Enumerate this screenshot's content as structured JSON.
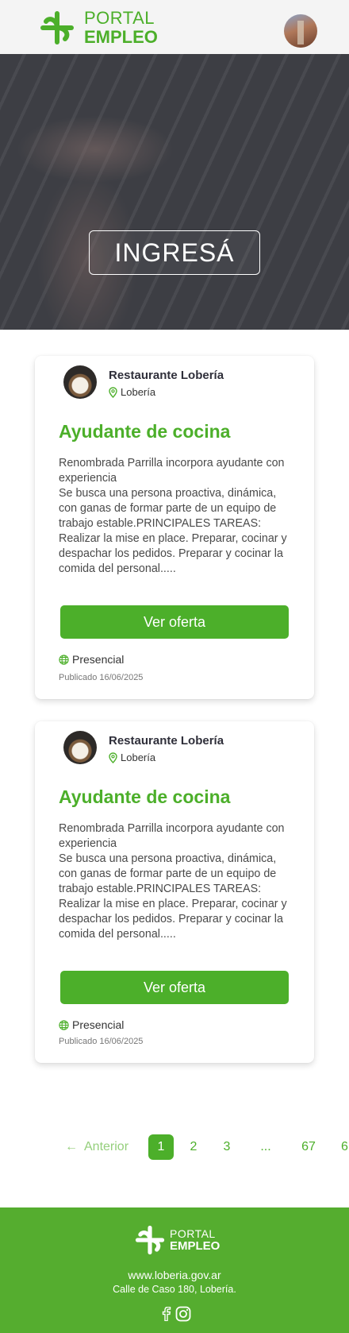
{
  "header": {
    "logo_line1": "PORTAL",
    "logo_line2": "EMPLEO",
    "avatar_icon": "user-avatar"
  },
  "hero": {
    "login_label": "INGRESÁ"
  },
  "jobs": [
    {
      "company": "Restaurante Lobería",
      "location": "Lobería",
      "title": "Ayudante de cocina",
      "description": "Renombrada Parrilla incorpora ayudante con experiencia\nSe busca una persona proactiva, dinámica, con ganas de formar parte de un equipo de trabajo estable.PRINCIPALES TAREAS: Realizar la mise en place. Preparar, cocinar y despachar los pedidos. Preparar y cocinar la comida del personal.....",
      "cta": "Ver oferta",
      "modality": "Presencial",
      "published": "Publicado 16/06/2025"
    },
    {
      "company": "Restaurante Lobería",
      "location": "Lobería",
      "title": "Ayudante de cocina",
      "description": "Renombrada Parrilla incorpora ayudante con experiencia\nSe busca una persona proactiva, dinámica, con ganas de formar parte de un equipo de trabajo estable.PRINCIPALES TAREAS: Realizar la mise en place. Preparar, cocinar y despachar los pedidos. Preparar y cocinar la comida del personal.....",
      "cta": "Ver oferta",
      "modality": "Presencial",
      "published": "Publicado 16/06/2025"
    }
  ],
  "pagination": {
    "prev_label": "Anterior",
    "pages": [
      "1",
      "2",
      "3",
      "...",
      "67",
      "6"
    ],
    "current": "1"
  },
  "footer": {
    "logo_line1": "PORTAL",
    "logo_line2": "EMPLEO",
    "url": "www.loberia.gov.ar",
    "address": "Calle de Caso 180, Lobería."
  },
  "colors": {
    "brand_green": "#4caf2a",
    "footer_green": "#55ad2f"
  }
}
